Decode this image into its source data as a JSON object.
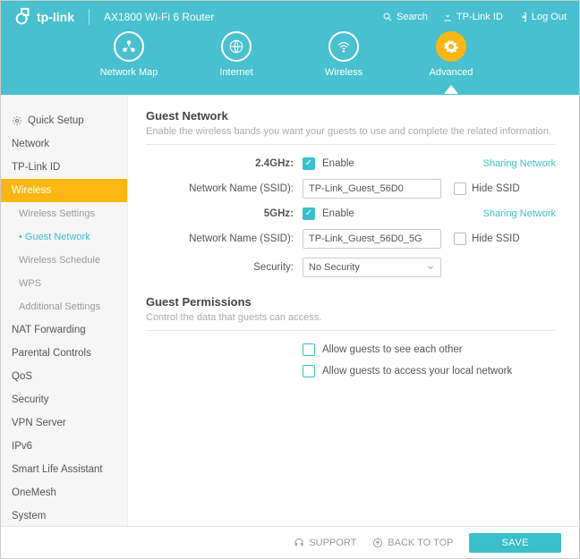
{
  "header": {
    "brand": "tp-link",
    "model": "AX1800 Wi-Fi 6 Router",
    "search_label": "Search",
    "tplink_id_label": "TP-Link ID",
    "logout_label": "Log Out"
  },
  "tabs": {
    "network_map": "Network Map",
    "internet": "Internet",
    "wireless": "Wireless",
    "advanced": "Advanced"
  },
  "sidebar": {
    "quick_setup": "Quick Setup",
    "network": "Network",
    "tplink_id": "TP-Link ID",
    "wireless": "Wireless",
    "wireless_sub": {
      "settings": "Wireless Settings",
      "guest_network": "Guest Network",
      "schedule": "Wireless Schedule",
      "wps": "WPS",
      "additional": "Additional Settings"
    },
    "nat": "NAT Forwarding",
    "parental": "Parental Controls",
    "qos": "QoS",
    "security": "Security",
    "vpn": "VPN Server",
    "ipv6": "IPv6",
    "smart_life": "Smart Life Assistant",
    "onemesh": "OneMesh",
    "system": "System"
  },
  "guest_network": {
    "title": "Guest Network",
    "desc": "Enable the wireless bands you want your guests to use and complete the related information.",
    "band24_label": "2.4GHz:",
    "band5_label": "5GHz:",
    "enable_label": "Enable",
    "ssid_label": "Network Name (SSID):",
    "ssid24_value": "TP-Link_Guest_56D0",
    "ssid5_value": "TP-Link_Guest_56D0_5G",
    "sharing_link": "Sharing Network",
    "hide_ssid": "Hide SSID",
    "security_label": "Security:",
    "security_value": "No Security"
  },
  "permissions": {
    "title": "Guest Permissions",
    "desc": "Control the data that guests can access.",
    "see_each_other": "Allow guests to see each other",
    "access_local": "Allow guests to access your local network"
  },
  "footer": {
    "support": "SUPPORT",
    "back_to_top": "BACK TO TOP",
    "save": "SAVE"
  }
}
